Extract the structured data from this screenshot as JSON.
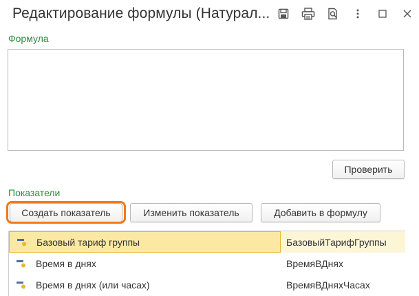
{
  "window": {
    "title": "Редактирование формулы (Натурал...",
    "icons": [
      "save-icon",
      "print-icon",
      "print-preview-icon",
      "more-icon",
      "minimize-icon",
      "close-icon"
    ]
  },
  "formula": {
    "label": "Формула",
    "value": "",
    "check_button": "Проверить"
  },
  "indicators": {
    "label": "Показатели",
    "buttons": {
      "create": "Создать показатель",
      "edit": "Изменить показатель",
      "add_to_formula": "Добавить в формулу"
    },
    "rows": [
      {
        "name": "Базовый тариф группы",
        "id": "БазовыйТарифГруппы",
        "selected": true
      },
      {
        "name": "Время в днях",
        "id": "ВремяВДнях",
        "selected": false
      },
      {
        "name": "Время в днях (или часах)",
        "id": "ВремяВДняхЧасах",
        "selected": false
      }
    ]
  },
  "colors": {
    "section_label": "#2e8b3e",
    "highlight_ring": "#f07a1a",
    "selected_row": "#fbe9a3",
    "selected_border": "#e8b830"
  }
}
